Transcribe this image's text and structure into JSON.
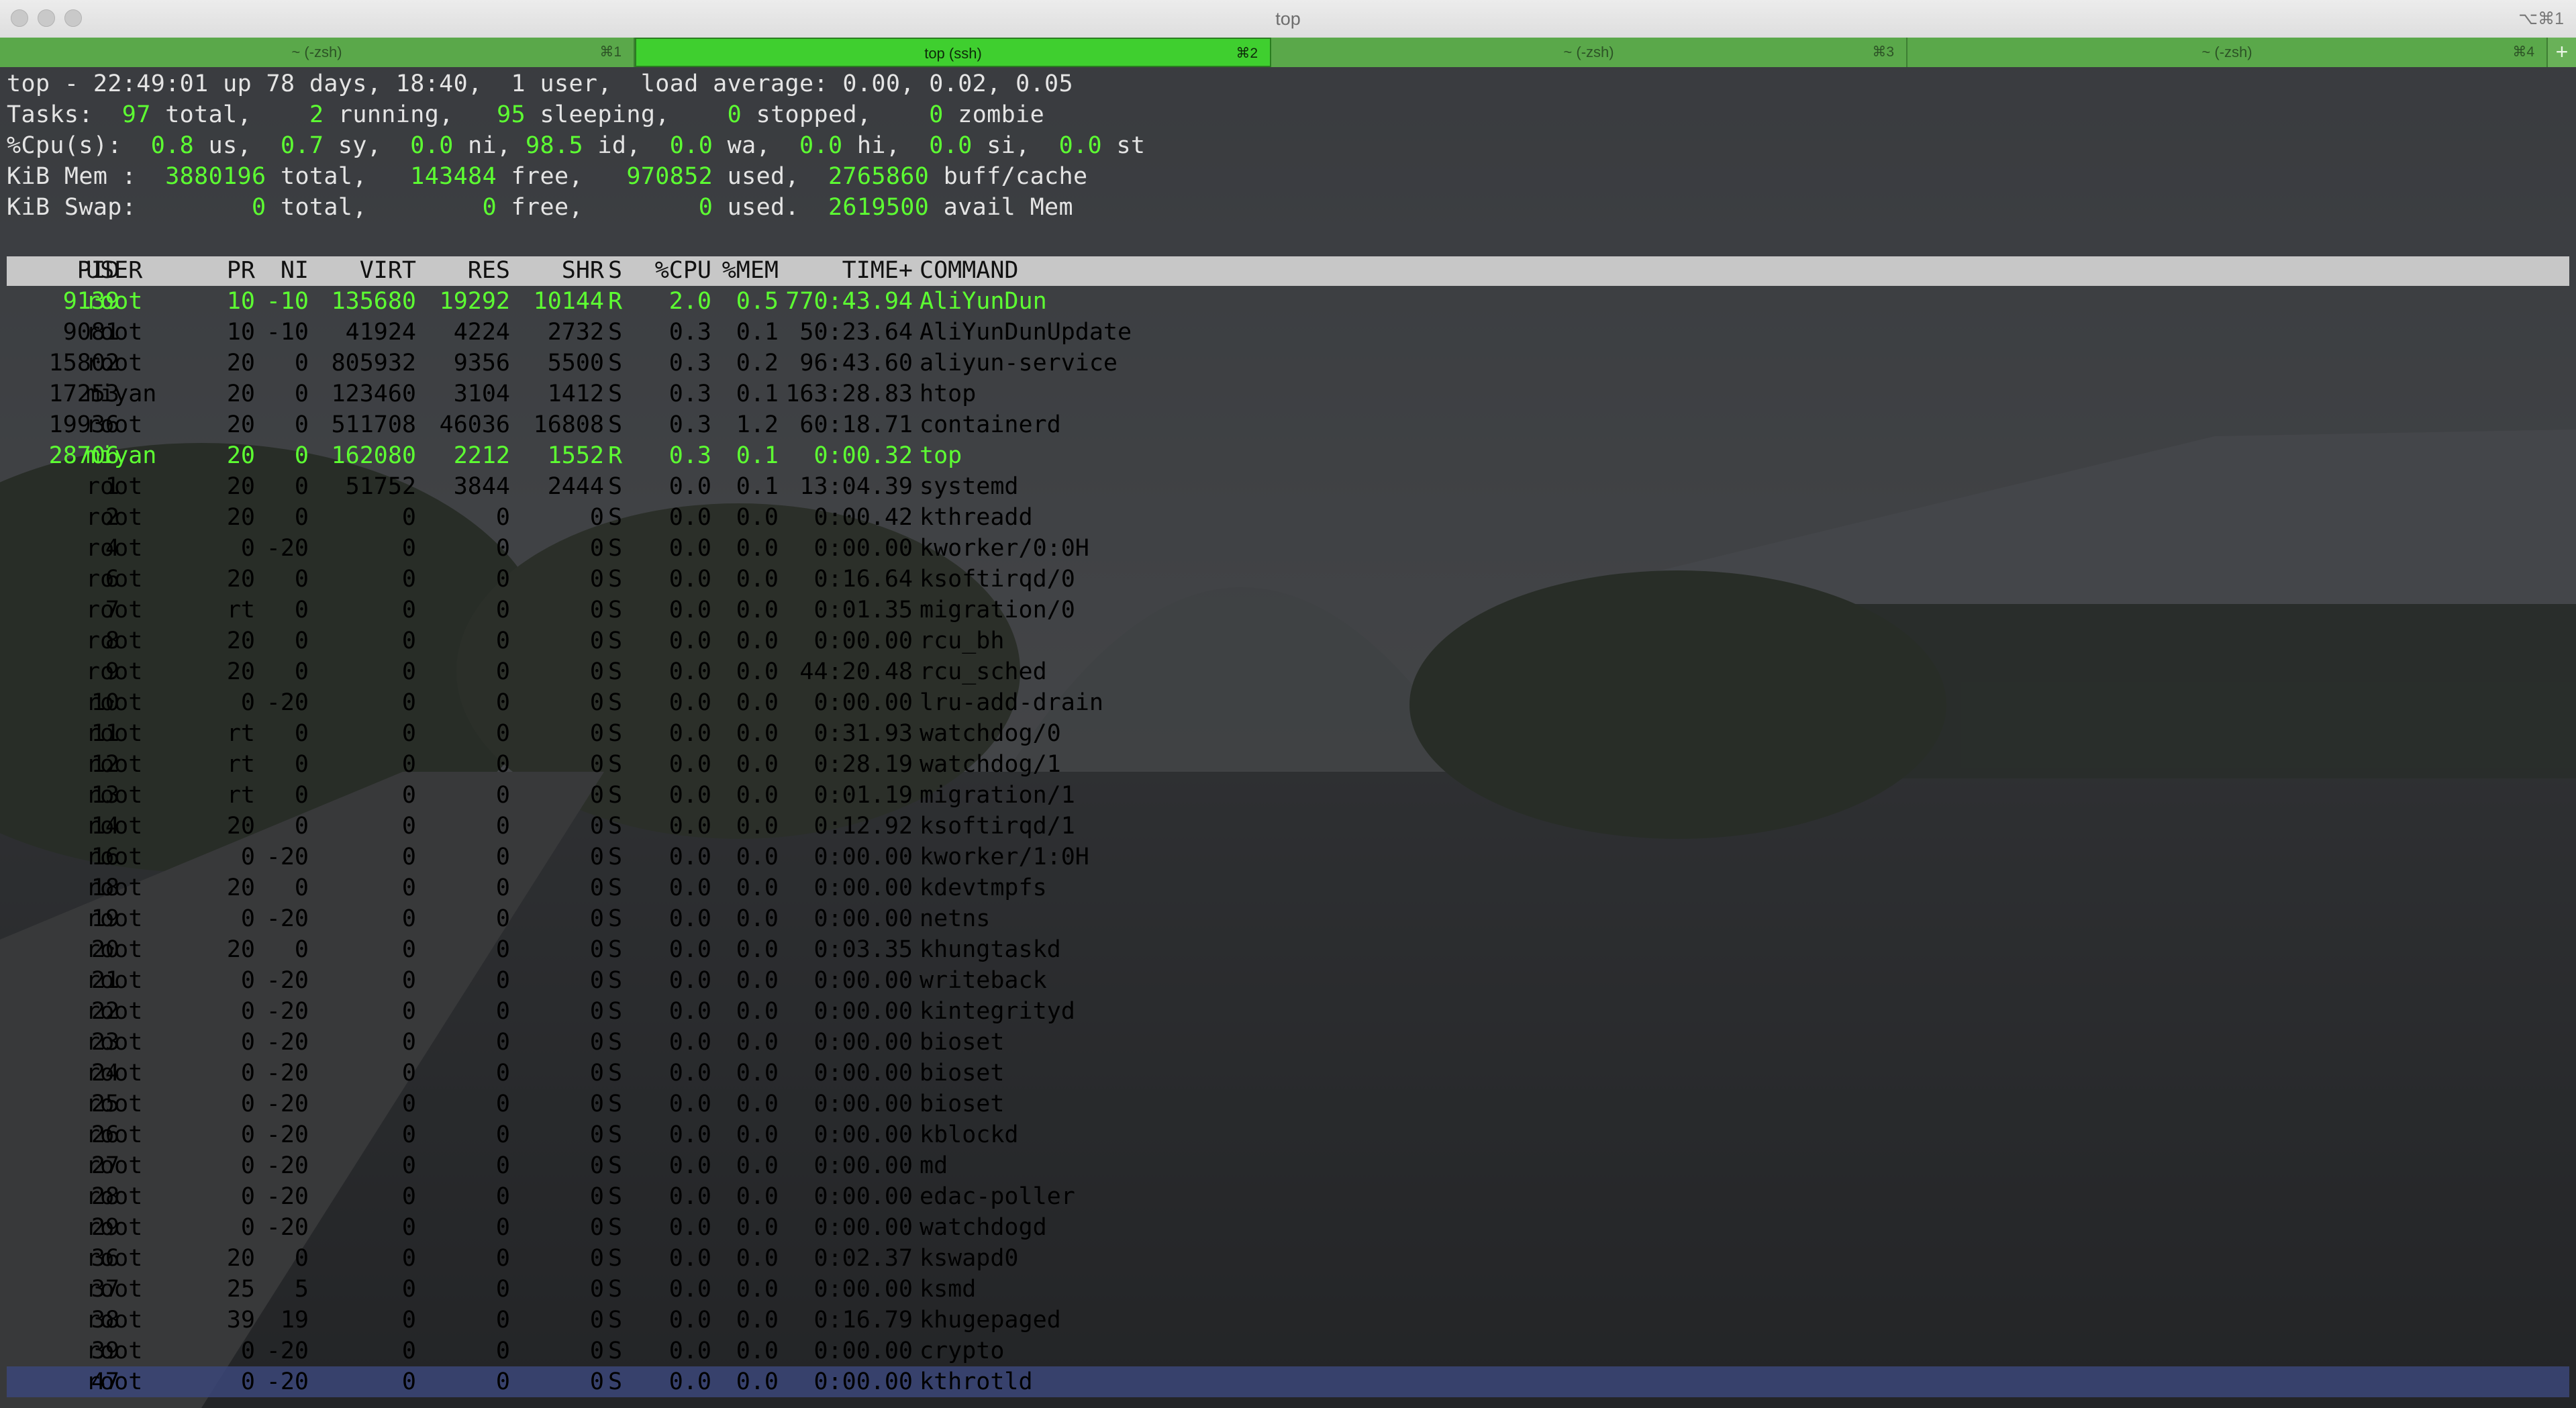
{
  "window": {
    "title": "top",
    "shortcut": "⌥⌘1"
  },
  "tabs": [
    {
      "label": "~ (-zsh)",
      "key": "⌘1",
      "active": false
    },
    {
      "label": "top (ssh)",
      "key": "⌘2",
      "active": true
    },
    {
      "label": "~ (-zsh)",
      "key": "⌘3",
      "active": false
    },
    {
      "label": "~ (-zsh)",
      "key": "⌘4",
      "active": false
    }
  ],
  "add_tab": "+",
  "summary": {
    "uptime": {
      "time": "22:49:01",
      "up": "78 days, 18:40",
      "users": "1",
      "load": "0.00, 0.02, 0.05"
    },
    "tasks": {
      "total": "97",
      "running": "2",
      "sleeping": "95",
      "stopped": "0",
      "zombie": "0"
    },
    "cpu": {
      "us": "0.8",
      "sy": "0.7",
      "ni": "0.0",
      "id": "98.5",
      "wa": "0.0",
      "hi": "0.0",
      "si": "0.0",
      "st": "0.0"
    },
    "mem": {
      "total": "3880196",
      "free": "143484",
      "used": "970852",
      "buff": "2765860"
    },
    "swap": {
      "total": "0",
      "free": "0",
      "used": "0",
      "avail": "2619500"
    }
  },
  "columns": [
    "PID",
    "USER",
    "PR",
    "NI",
    "VIRT",
    "RES",
    "SHR",
    "S",
    "%CPU",
    "%MEM",
    "TIME+",
    "COMMAND"
  ],
  "processes": [
    [
      "9139",
      "root",
      "10",
      "-10",
      "135680",
      "19292",
      "10144",
      "R",
      "2.0",
      "0.5",
      "770:43.94",
      "AliYunDun"
    ],
    [
      "9081",
      "root",
      "10",
      "-10",
      "41924",
      "4224",
      "2732",
      "S",
      "0.3",
      "0.1",
      "50:23.64",
      "AliYunDunUpdate"
    ],
    [
      "15802",
      "root",
      "20",
      "0",
      "805932",
      "9356",
      "5500",
      "S",
      "0.3",
      "0.2",
      "96:43.60",
      "aliyun-service"
    ],
    [
      "17253",
      "miyan",
      "20",
      "0",
      "123460",
      "3104",
      "1412",
      "S",
      "0.3",
      "0.1",
      "163:28.83",
      "htop"
    ],
    [
      "19936",
      "root",
      "20",
      "0",
      "511708",
      "46036",
      "16808",
      "S",
      "0.3",
      "1.2",
      "60:18.71",
      "containerd"
    ],
    [
      "28706",
      "miyan",
      "20",
      "0",
      "162080",
      "2212",
      "1552",
      "R",
      "0.3",
      "0.1",
      "0:00.32",
      "top"
    ],
    [
      "1",
      "root",
      "20",
      "0",
      "51752",
      "3844",
      "2444",
      "S",
      "0.0",
      "0.1",
      "13:04.39",
      "systemd"
    ],
    [
      "2",
      "root",
      "20",
      "0",
      "0",
      "0",
      "0",
      "S",
      "0.0",
      "0.0",
      "0:00.42",
      "kthreadd"
    ],
    [
      "4",
      "root",
      "0",
      "-20",
      "0",
      "0",
      "0",
      "S",
      "0.0",
      "0.0",
      "0:00.00",
      "kworker/0:0H"
    ],
    [
      "6",
      "root",
      "20",
      "0",
      "0",
      "0",
      "0",
      "S",
      "0.0",
      "0.0",
      "0:16.64",
      "ksoftirqd/0"
    ],
    [
      "7",
      "root",
      "rt",
      "0",
      "0",
      "0",
      "0",
      "S",
      "0.0",
      "0.0",
      "0:01.35",
      "migration/0"
    ],
    [
      "8",
      "root",
      "20",
      "0",
      "0",
      "0",
      "0",
      "S",
      "0.0",
      "0.0",
      "0:00.00",
      "rcu_bh"
    ],
    [
      "9",
      "root",
      "20",
      "0",
      "0",
      "0",
      "0",
      "S",
      "0.0",
      "0.0",
      "44:20.48",
      "rcu_sched"
    ],
    [
      "10",
      "root",
      "0",
      "-20",
      "0",
      "0",
      "0",
      "S",
      "0.0",
      "0.0",
      "0:00.00",
      "lru-add-drain"
    ],
    [
      "11",
      "root",
      "rt",
      "0",
      "0",
      "0",
      "0",
      "S",
      "0.0",
      "0.0",
      "0:31.93",
      "watchdog/0"
    ],
    [
      "12",
      "root",
      "rt",
      "0",
      "0",
      "0",
      "0",
      "S",
      "0.0",
      "0.0",
      "0:28.19",
      "watchdog/1"
    ],
    [
      "13",
      "root",
      "rt",
      "0",
      "0",
      "0",
      "0",
      "S",
      "0.0",
      "0.0",
      "0:01.19",
      "migration/1"
    ],
    [
      "14",
      "root",
      "20",
      "0",
      "0",
      "0",
      "0",
      "S",
      "0.0",
      "0.0",
      "0:12.92",
      "ksoftirqd/1"
    ],
    [
      "16",
      "root",
      "0",
      "-20",
      "0",
      "0",
      "0",
      "S",
      "0.0",
      "0.0",
      "0:00.00",
      "kworker/1:0H"
    ],
    [
      "18",
      "root",
      "20",
      "0",
      "0",
      "0",
      "0",
      "S",
      "0.0",
      "0.0",
      "0:00.00",
      "kdevtmpfs"
    ],
    [
      "19",
      "root",
      "0",
      "-20",
      "0",
      "0",
      "0",
      "S",
      "0.0",
      "0.0",
      "0:00.00",
      "netns"
    ],
    [
      "20",
      "root",
      "20",
      "0",
      "0",
      "0",
      "0",
      "S",
      "0.0",
      "0.0",
      "0:03.35",
      "khungtaskd"
    ],
    [
      "21",
      "root",
      "0",
      "-20",
      "0",
      "0",
      "0",
      "S",
      "0.0",
      "0.0",
      "0:00.00",
      "writeback"
    ],
    [
      "22",
      "root",
      "0",
      "-20",
      "0",
      "0",
      "0",
      "S",
      "0.0",
      "0.0",
      "0:00.00",
      "kintegrityd"
    ],
    [
      "23",
      "root",
      "0",
      "-20",
      "0",
      "0",
      "0",
      "S",
      "0.0",
      "0.0",
      "0:00.00",
      "bioset"
    ],
    [
      "24",
      "root",
      "0",
      "-20",
      "0",
      "0",
      "0",
      "S",
      "0.0",
      "0.0",
      "0:00.00",
      "bioset"
    ],
    [
      "25",
      "root",
      "0",
      "-20",
      "0",
      "0",
      "0",
      "S",
      "0.0",
      "0.0",
      "0:00.00",
      "bioset"
    ],
    [
      "26",
      "root",
      "0",
      "-20",
      "0",
      "0",
      "0",
      "S",
      "0.0",
      "0.0",
      "0:00.00",
      "kblockd"
    ],
    [
      "27",
      "root",
      "0",
      "-20",
      "0",
      "0",
      "0",
      "S",
      "0.0",
      "0.0",
      "0:00.00",
      "md"
    ],
    [
      "28",
      "root",
      "0",
      "-20",
      "0",
      "0",
      "0",
      "S",
      "0.0",
      "0.0",
      "0:00.00",
      "edac-poller"
    ],
    [
      "29",
      "root",
      "0",
      "-20",
      "0",
      "0",
      "0",
      "S",
      "0.0",
      "0.0",
      "0:00.00",
      "watchdogd"
    ],
    [
      "36",
      "root",
      "20",
      "0",
      "0",
      "0",
      "0",
      "S",
      "0.0",
      "0.0",
      "0:02.37",
      "kswapd0"
    ],
    [
      "37",
      "root",
      "25",
      "5",
      "0",
      "0",
      "0",
      "S",
      "0.0",
      "0.0",
      "0:00.00",
      "ksmd"
    ],
    [
      "38",
      "root",
      "39",
      "19",
      "0",
      "0",
      "0",
      "S",
      "0.0",
      "0.0",
      "0:16.79",
      "khugepaged"
    ],
    [
      "39",
      "root",
      "0",
      "-20",
      "0",
      "0",
      "0",
      "S",
      "0.0",
      "0.0",
      "0:00.00",
      "crypto"
    ],
    [
      "47",
      "root",
      "0",
      "-20",
      "0",
      "0",
      "0",
      "S",
      "0.0",
      "0.0",
      "0:00.00",
      "kthrotld"
    ]
  ],
  "running_rows": [
    0,
    5
  ],
  "selected_row": 35,
  "colors": {
    "highlight": "#5dff32",
    "tab_active": "#3fcf2f",
    "tab_inactive": "#5aa84a",
    "selection": "#3a4676"
  }
}
